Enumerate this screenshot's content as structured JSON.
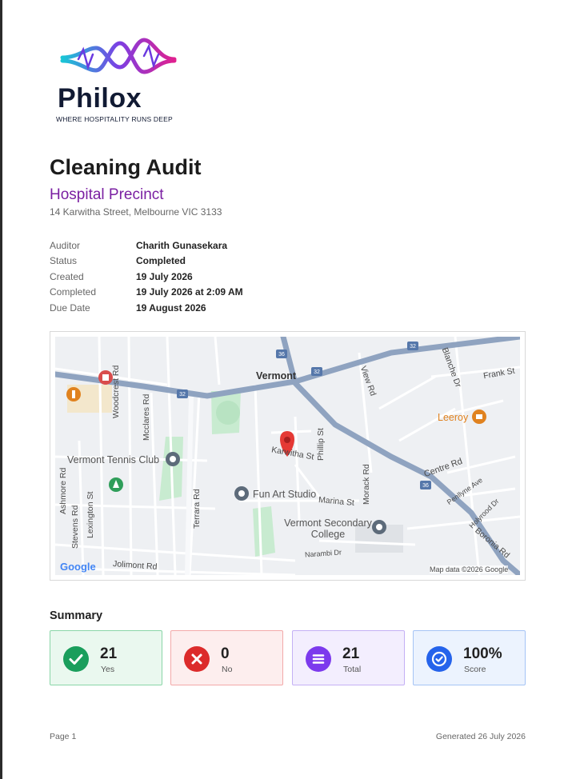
{
  "logo": {
    "wordmark": "Philox",
    "tagline": "WHERE HOSPITALITY RUNS DEEP"
  },
  "report": {
    "title": "Cleaning Audit",
    "site": "Hospital Precinct",
    "address": "14 Karwitha Street, Melbourne VIC 3133"
  },
  "details": [
    {
      "label": "Auditor",
      "value": "Charith Gunasekara"
    },
    {
      "label": "Status",
      "value": "Completed"
    },
    {
      "label": "Created",
      "value": "19 July 2026"
    },
    {
      "label": "Completed",
      "value": "19 July 2026 at 2:09 AM"
    },
    {
      "label": "Due Date",
      "value": "19 August 2026"
    }
  ],
  "map": {
    "suburb": "Vermont",
    "route_shields": [
      "36",
      "32",
      "32",
      "32",
      "36"
    ],
    "streets": [
      "Woodcrest Rd",
      "Mcclares Rd",
      "Terrara Rd",
      "Ashmore Rd",
      "Stevens Rd",
      "Lexington St",
      "Jolimont Rd",
      "Karwitha St",
      "Phillip St",
      "Marina St",
      "Morack Rd",
      "View Rd",
      "Blanche Dr",
      "Frank St",
      "Centre Rd",
      "Penllyne Ave",
      "Holyrood Dr",
      "Narambi Dr",
      "Boronia Rd"
    ],
    "places": [
      "Vermont Tennis Club",
      "Fun Art Studio",
      "Vermont Secondary College",
      "Leeroy"
    ],
    "attribution": "Map data ©2026 Google",
    "brand": "Google",
    "colors": {
      "land": "#eef0f3",
      "major_road": "#8fa3c0",
      "park": "#c8ebd0",
      "pin": "#e53935"
    }
  },
  "summary": {
    "heading": "Summary",
    "cards": [
      {
        "value": "21",
        "label": "Yes",
        "icon": "check-icon",
        "accent": "#1a9e5c"
      },
      {
        "value": "0",
        "label": "No",
        "icon": "close-icon",
        "accent": "#dc2b2b"
      },
      {
        "value": "21",
        "label": "Total",
        "icon": "list-icon",
        "accent": "#7c3aed"
      },
      {
        "value": "100%",
        "label": "Score",
        "icon": "badge-check-icon",
        "accent": "#2563eb"
      }
    ]
  },
  "footer": {
    "page": "Page 1",
    "generated": "Generated 26 July 2026"
  }
}
